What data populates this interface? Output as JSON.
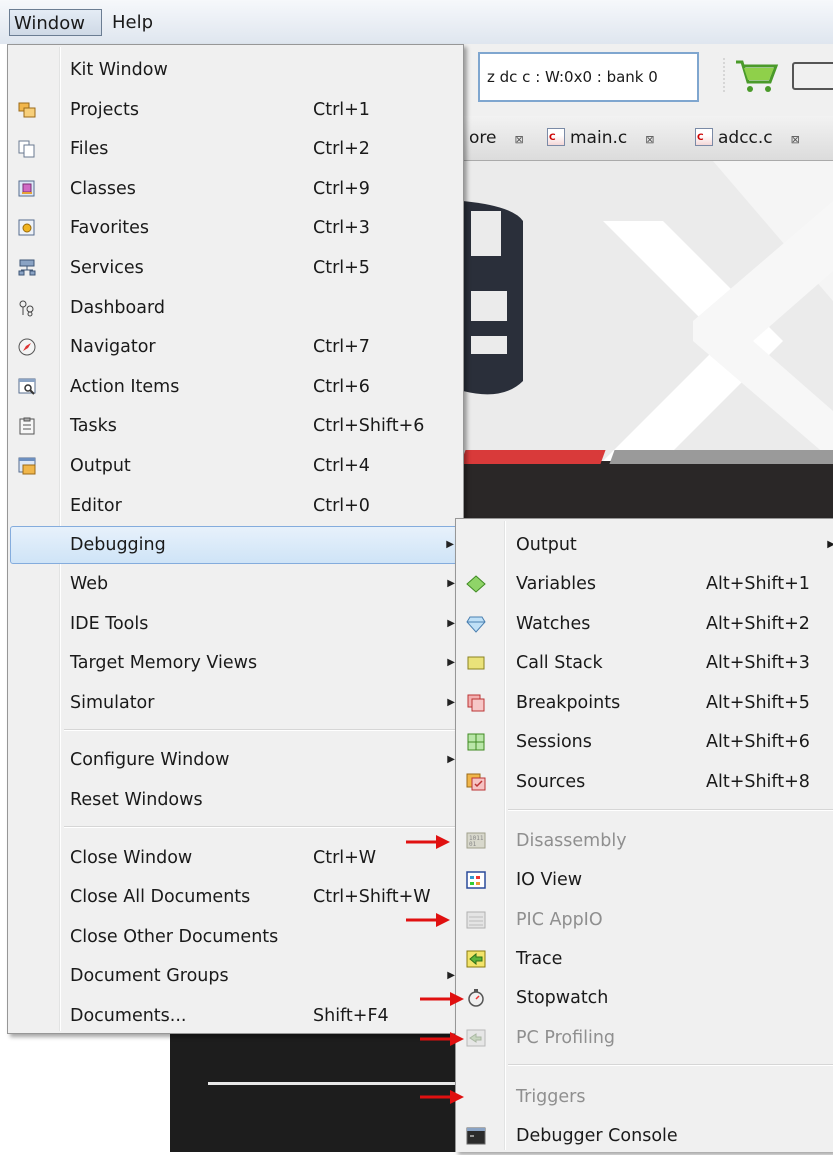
{
  "menubar": {
    "window": "Window",
    "help": "Help"
  },
  "toolbar": {
    "status_text": "z dc c  : W:0x0 : bank 0"
  },
  "tabs": [
    {
      "label": "ore"
    },
    {
      "label": "main.c"
    },
    {
      "label": "adcc.c"
    }
  ],
  "window_menu": {
    "items": [
      {
        "label": "Kit Window",
        "shortcut": "",
        "icon": "none"
      },
      {
        "label": "Projects",
        "shortcut": "Ctrl+1",
        "icon": "projects-icon"
      },
      {
        "label": "Files",
        "shortcut": "Ctrl+2",
        "icon": "files-icon"
      },
      {
        "label": "Classes",
        "shortcut": "Ctrl+9",
        "icon": "classes-icon"
      },
      {
        "label": "Favorites",
        "shortcut": "Ctrl+3",
        "icon": "favorites-icon"
      },
      {
        "label": "Services",
        "shortcut": "Ctrl+5",
        "icon": "services-icon"
      },
      {
        "label": "Dashboard",
        "shortcut": "",
        "icon": "dashboard-icon"
      },
      {
        "label": "Navigator",
        "shortcut": "Ctrl+7",
        "icon": "navigator-icon"
      },
      {
        "label": "Action Items",
        "shortcut": "Ctrl+6",
        "icon": "action-items-icon"
      },
      {
        "label": "Tasks",
        "shortcut": "Ctrl+Shift+6",
        "icon": "tasks-icon"
      },
      {
        "label": "Output",
        "shortcut": "Ctrl+4",
        "icon": "output-icon"
      },
      {
        "label": "Editor",
        "shortcut": "Ctrl+0",
        "icon": "none"
      },
      {
        "label": "Debugging",
        "shortcut": "",
        "submenu": true
      },
      {
        "label": "Web",
        "shortcut": "",
        "submenu": true
      },
      {
        "label": "IDE Tools",
        "shortcut": "",
        "submenu": true
      },
      {
        "label": "Target Memory Views",
        "shortcut": "",
        "submenu": true
      },
      {
        "label": "Simulator",
        "shortcut": "",
        "submenu": true
      },
      {
        "label": "Configure Window",
        "shortcut": "",
        "submenu": true
      },
      {
        "label": "Reset Windows",
        "shortcut": ""
      },
      {
        "label": "Close Window",
        "shortcut": "Ctrl+W"
      },
      {
        "label": "Close All Documents",
        "shortcut": "Ctrl+Shift+W"
      },
      {
        "label": "Close Other Documents",
        "shortcut": ""
      },
      {
        "label": "Document Groups",
        "shortcut": "",
        "submenu": true
      },
      {
        "label": "Documents...",
        "shortcut": "Shift+F4"
      }
    ]
  },
  "debugging_submenu": {
    "items": [
      {
        "label": "Output",
        "shortcut": "",
        "submenu": true,
        "enabled": true
      },
      {
        "label": "Variables",
        "shortcut": "Alt+Shift+1",
        "icon": "variables-icon",
        "enabled": true
      },
      {
        "label": "Watches",
        "shortcut": "Alt+Shift+2",
        "icon": "watches-icon",
        "enabled": true
      },
      {
        "label": "Call Stack",
        "shortcut": "Alt+Shift+3",
        "icon": "call-stack-icon",
        "enabled": true
      },
      {
        "label": "Breakpoints",
        "shortcut": "Alt+Shift+5",
        "icon": "breakpoints-icon",
        "enabled": true
      },
      {
        "label": "Sessions",
        "shortcut": "Alt+Shift+6",
        "icon": "sessions-icon",
        "enabled": true
      },
      {
        "label": "Sources",
        "shortcut": "Alt+Shift+8",
        "icon": "sources-icon",
        "enabled": true
      },
      {
        "label": "Disassembly",
        "shortcut": "",
        "icon": "disassembly-icon",
        "enabled": false
      },
      {
        "label": "IO View",
        "shortcut": "",
        "icon": "io-view-icon",
        "enabled": true
      },
      {
        "label": "PIC AppIO",
        "shortcut": "",
        "icon": "pic-appio-icon",
        "enabled": false
      },
      {
        "label": "Trace",
        "shortcut": "",
        "icon": "trace-icon",
        "enabled": true
      },
      {
        "label": "Stopwatch",
        "shortcut": "",
        "icon": "stopwatch-icon",
        "enabled": true
      },
      {
        "label": "PC Profiling",
        "shortcut": "",
        "icon": "pc-profiling-icon",
        "enabled": false
      },
      {
        "label": "Triggers",
        "shortcut": "",
        "icon": "none",
        "enabled": false
      },
      {
        "label": "Debugger Console",
        "shortcut": "",
        "icon": "debugger-console-icon",
        "enabled": true
      }
    ]
  },
  "colors": {
    "menu_bg": "#f0f0f0",
    "highlight": "#cfe4f7",
    "arrow_red": "#e01010",
    "disabled_text": "#8f8f8f"
  }
}
